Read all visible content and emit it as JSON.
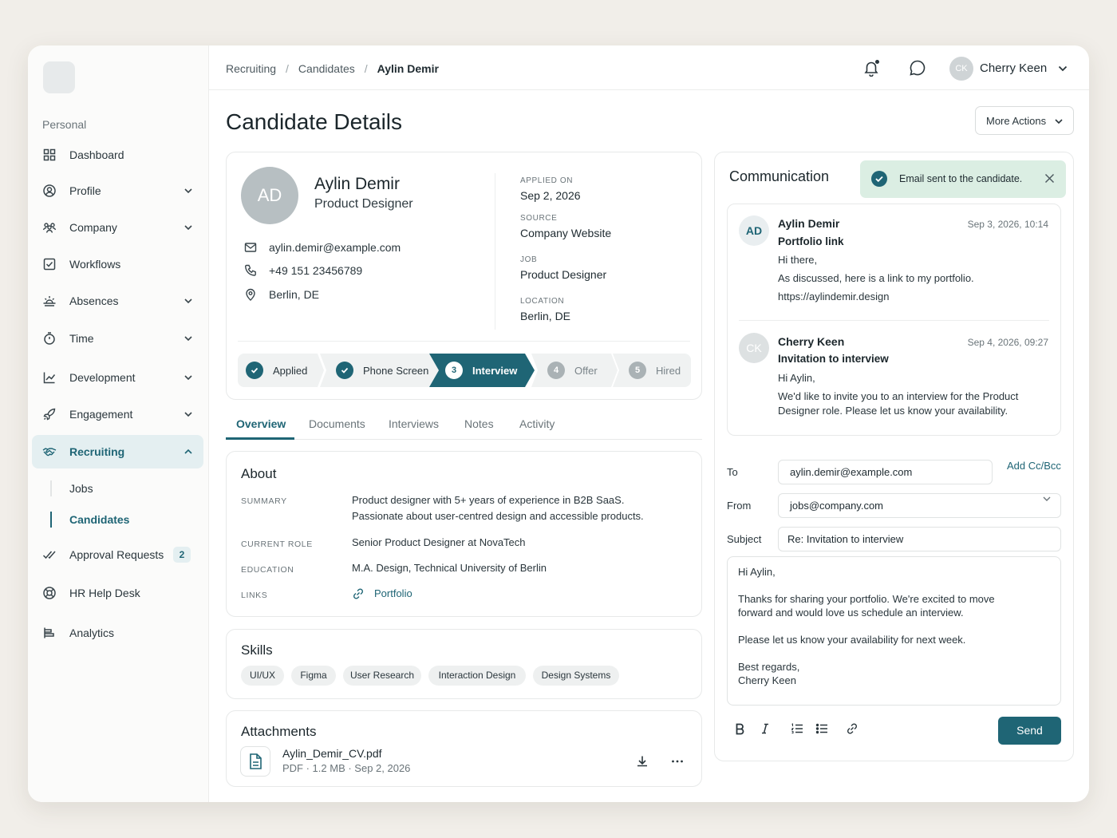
{
  "sidebar": {
    "section": "Personal",
    "items": [
      {
        "label": "Dashboard",
        "icon": "grid-icon"
      },
      {
        "label": "Profile",
        "icon": "user-circle-icon"
      },
      {
        "label": "Company",
        "icon": "people-icon"
      },
      {
        "label": "Workflows",
        "icon": "checkbox-icon"
      },
      {
        "label": "Absences",
        "icon": "sunrise-icon"
      },
      {
        "label": "Time",
        "icon": "stopwatch-icon"
      },
      {
        "label": "Development",
        "icon": "trend-chart-icon"
      },
      {
        "label": "Engagement",
        "icon": "rocket-icon"
      },
      {
        "label": "Recruiting",
        "icon": "handshake-icon"
      },
      {
        "label": "Approval Requests",
        "icon": "double-check-icon",
        "badge": "2"
      },
      {
        "label": "HR Help Desk",
        "icon": "lifebuoy-icon"
      },
      {
        "label": "Analytics",
        "icon": "bar-list-icon"
      }
    ],
    "sub_items": [
      {
        "label": "Jobs"
      },
      {
        "label": "Candidates"
      }
    ]
  },
  "topbar": {
    "breadcrumb": [
      "Recruiting",
      "Candidates",
      "Aylin Demir"
    ],
    "separator": "/",
    "user": {
      "initials": "CK",
      "name": "Cherry Keen"
    }
  },
  "page": {
    "title": "Candidate Details",
    "more_actions": "More Actions"
  },
  "candidate": {
    "initials": "AD",
    "name": "Aylin Demir",
    "role": "Product Designer",
    "email": "aylin.demir@example.com",
    "phone": "+49 151 23456789",
    "location": "Berlin, DE",
    "meta": [
      {
        "label": "APPLIED ON",
        "value": "Sep 2, 2026"
      },
      {
        "label": "SOURCE",
        "value": "Company Website"
      },
      {
        "label": "JOB",
        "value": "Product Designer"
      },
      {
        "label": "LOCATION",
        "value": "Berlin, DE"
      }
    ],
    "stages": [
      {
        "num": "1",
        "label": "Applied",
        "state": "done"
      },
      {
        "num": "2",
        "label": "Phone Screen",
        "state": "done"
      },
      {
        "num": "3",
        "label": "Interview",
        "state": "current"
      },
      {
        "num": "4",
        "label": "Offer",
        "state": "todo"
      },
      {
        "num": "5",
        "label": "Hired",
        "state": "todo"
      }
    ]
  },
  "tabs": [
    "Overview",
    "Documents",
    "Interviews",
    "Notes",
    "Activity"
  ],
  "about": {
    "title": "About",
    "summary_label": "SUMMARY",
    "summary_1": "Product designer with 5+ years of experience in B2B SaaS.",
    "summary_2": "Passionate about user-centred design and accessible products.",
    "role_label": "CURRENT ROLE",
    "role": "Senior Product Designer at NovaTech",
    "education_label": "EDUCATION",
    "education": "M.A. Design, Technical University of Berlin",
    "links_label": "LINKS",
    "link": "Portfolio"
  },
  "skills": {
    "title": "Skills",
    "items": [
      "UI/UX",
      "Figma",
      "User Research",
      "Interaction Design",
      "Design Systems"
    ]
  },
  "attachments": {
    "title": "Attachments",
    "file_name": "Aylin_Demir_CV.pdf",
    "file_meta": "PDF · 1.2 MB · Sep 2, 2026"
  },
  "communication": {
    "title": "Communication",
    "toast": "Email sent to the candidate.",
    "messages": [
      {
        "initials": "AD",
        "from": "Aylin Demir",
        "time": "Sep 3, 2026, 10:14",
        "subject": "Portfolio link",
        "lines": [
          "Hi there,",
          "As discussed, here is a link to my portfolio."
        ],
        "link": "https://aylindemir.design"
      },
      {
        "initials": "CK",
        "from": "Cherry Keen",
        "time": "Sep 4, 2026, 09:27",
        "subject": "Invitation to interview",
        "lines": [
          "Hi Aylin,",
          "We'd like to invite you to an interview for the Product",
          "Designer role. Please let us know your availability."
        ]
      }
    ],
    "form": {
      "to_label": "To",
      "to": "aylin.demir@example.com",
      "cc": "Add Cc/Bcc",
      "from_label": "From",
      "from": "jobs@company.com",
      "subject_label": "Subject",
      "subject": "Re: Invitation to interview",
      "body": [
        "Hi Aylin,",
        "Thanks for sharing your portfolio. We're excited to move",
        "forward and would love us schedule an interview.",
        "Please let us know your availability for next week.",
        "Best regards,",
        "Cherry Keen"
      ],
      "send": "Send"
    }
  },
  "colors": {
    "accent": "#1f6575",
    "toast_bg": "#dbeee3",
    "background": "#f1eee9"
  }
}
